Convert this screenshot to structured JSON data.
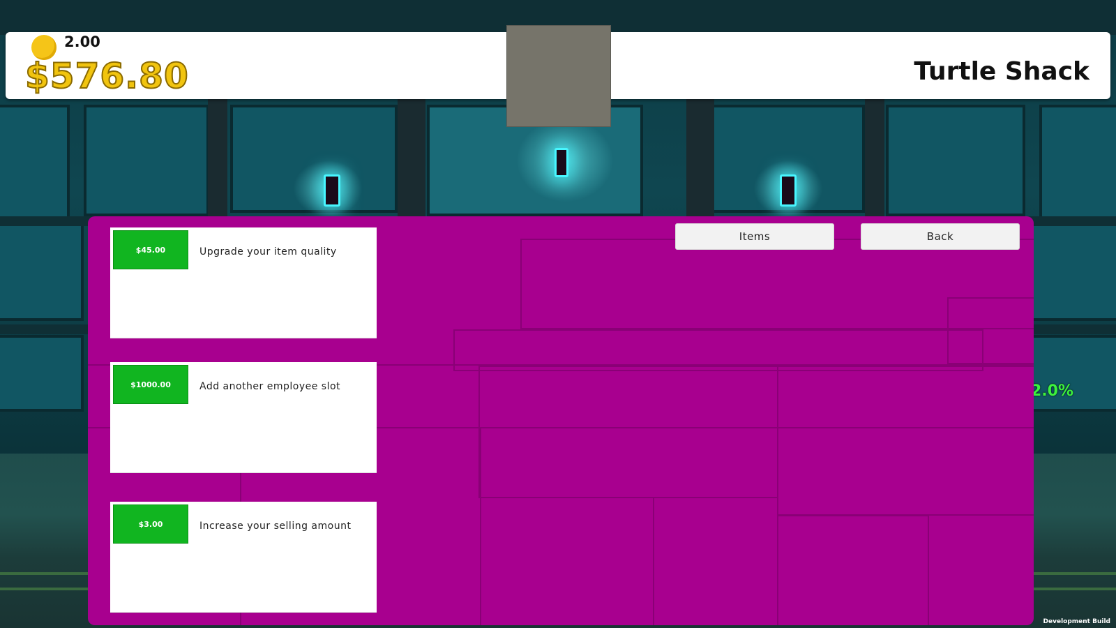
{
  "hud": {
    "coin_count": "2.00",
    "cash": "$576.80",
    "shop_name": "Turtle Shack"
  },
  "side_readout": {
    "percent": "2.0%"
  },
  "panel": {
    "items_button": "Items",
    "back_button": "Back",
    "upgrades": [
      {
        "price": "$45.00",
        "description": "Upgrade your item quality"
      },
      {
        "price": "$1000.00",
        "description": "Add another employee slot"
      },
      {
        "price": "$3.00",
        "description": "Increase your selling amount"
      }
    ]
  },
  "footer": {
    "build_label": "Development Build"
  },
  "colors": {
    "panel": "#a8008f",
    "price_button": "#11b520",
    "cash_text": "#f1c40f",
    "lamp_glow": "#48f6ff"
  },
  "icons": {
    "coin": "coin-icon"
  }
}
